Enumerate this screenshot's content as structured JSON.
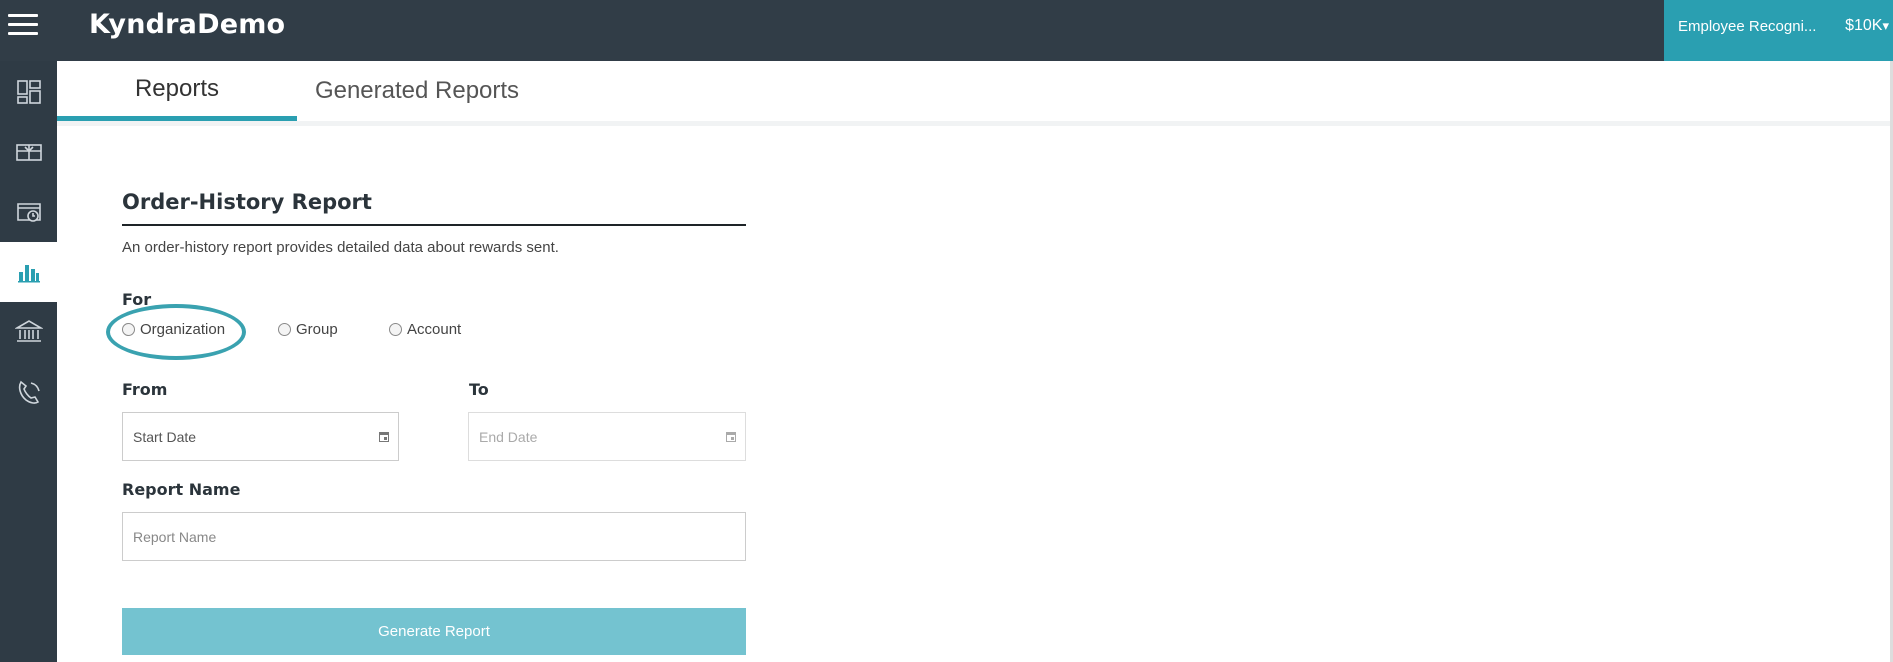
{
  "header": {
    "brand": "KyndraDemo",
    "program_name": "Employee Recogni...",
    "program_balance": "$10K",
    "balance_caret": "▾"
  },
  "sidebar": {
    "items": [
      {
        "icon": "dashboard-icon",
        "active": false
      },
      {
        "icon": "gift-card-icon",
        "active": false
      },
      {
        "icon": "order-history-icon",
        "active": false
      },
      {
        "icon": "bar-chart-icon",
        "active": true
      },
      {
        "icon": "bank-icon",
        "active": false
      },
      {
        "icon": "support-phone-icon",
        "active": false
      }
    ]
  },
  "tabs": [
    {
      "label": "Reports",
      "active": true
    },
    {
      "label": "Generated Reports",
      "active": false
    }
  ],
  "report": {
    "title": "Order-History Report",
    "description": "An order-history report provides detailed data about rewards sent.",
    "for_label": "For",
    "options": [
      "Organization",
      "Group",
      "Account"
    ],
    "from_label": "From",
    "to_label": "To",
    "start_placeholder": "Start Date",
    "end_placeholder": "End Date",
    "name_label": "Report Name",
    "name_placeholder": "Report Name",
    "generate_label": "Generate Report"
  },
  "colors": {
    "topbar": "#313d47",
    "accent": "#2a9fb1",
    "button": "#74c3d0"
  }
}
